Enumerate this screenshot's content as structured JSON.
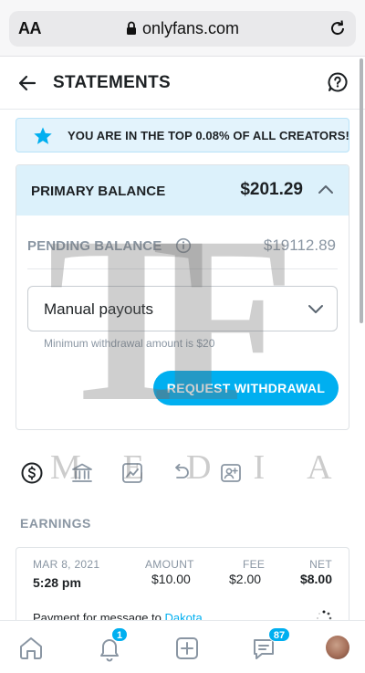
{
  "browser": {
    "text_size_label": "AA",
    "url": "onlyfans.com"
  },
  "header": {
    "title": "STATEMENTS"
  },
  "banner": {
    "text": "YOU ARE IN THE TOP 0.08% OF ALL CREATORS!"
  },
  "balance": {
    "primary_label": "PRIMARY BALANCE",
    "primary_amount": "$201.29",
    "pending_label": "PENDING BALANCE",
    "pending_amount": "$19112.89",
    "payout_select_value": "Manual payouts",
    "min_note": "Minimum withdrawal amount is $20",
    "withdraw_button": "REQUEST WITHDRAWAL"
  },
  "tabs": [
    {
      "icon": "dollar-circle-icon"
    },
    {
      "icon": "bank-icon"
    },
    {
      "icon": "chart-icon"
    },
    {
      "icon": "refund-icon"
    },
    {
      "icon": "user-card-icon"
    }
  ],
  "watermark": {
    "logo_text": "TF",
    "sub_text": "MEDIA"
  },
  "earnings": {
    "heading": "EARNINGS",
    "columns": {
      "amount": "AMOUNT",
      "fee": "FEE",
      "net": "NET"
    },
    "rows": [
      {
        "date": "MAR 8, 2021",
        "time": "5:28 pm",
        "amount": "$10.00",
        "fee": "$2.00",
        "net": "$8.00",
        "description": "Payment for message to",
        "recipient": "Dakota"
      }
    ]
  },
  "bottom_nav": {
    "notifications_badge": "1",
    "messages_badge": "87"
  },
  "colors": {
    "accent": "#00aff0",
    "banner_bg": "#e3f3fc",
    "primary_row_bg": "#dcf1fb",
    "muted_text": "#8a96a3"
  }
}
